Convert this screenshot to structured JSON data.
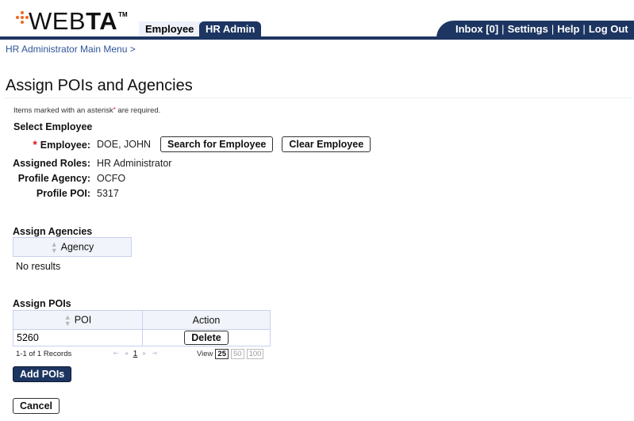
{
  "header": {
    "logo": {
      "text_light": "WEB",
      "text_bold": "TA",
      "trademark": "TM",
      "accent_color": "#f26722"
    },
    "tabs": [
      {
        "label": "Employee",
        "active": false
      },
      {
        "label": "HR Admin",
        "active": true
      }
    ],
    "utility_links": [
      {
        "label": "Inbox [0]"
      },
      {
        "label": "Settings"
      },
      {
        "label": "Help"
      },
      {
        "label": "Log Out"
      }
    ],
    "separator": "|",
    "brand_color": "#1d3561"
  },
  "breadcrumb": {
    "items": [
      "HR Administrator Main Menu"
    ],
    "separator": ">"
  },
  "page": {
    "title": "Assign POIs and Agencies",
    "required_note_prefix": "Items marked with an asterisk",
    "required_note_suffix": " are required.",
    "asterisk": "*"
  },
  "select_employee": {
    "heading": "Select Employee",
    "employee_label": "Employee:",
    "employee_value": "DOE, JOHN",
    "search_button": "Search for Employee",
    "clear_button": "Clear Employee",
    "fields": [
      {
        "label": "Assigned Roles:",
        "value": "HR Administrator"
      },
      {
        "label": "Profile Agency:",
        "value": "OCFO"
      },
      {
        "label": "Profile POI:",
        "value": "5317"
      }
    ]
  },
  "assign_agencies": {
    "heading": "Assign Agencies",
    "columns": [
      "Agency"
    ],
    "empty_text": "No results"
  },
  "assign_pois": {
    "heading": "Assign POIs",
    "columns": [
      "POI",
      "Action"
    ],
    "rows": [
      {
        "poi": "5260",
        "action": "Delete"
      }
    ],
    "pager": {
      "records": "1-1 of 1 Records",
      "first": "⇤",
      "prev": "◂",
      "current_page": "1",
      "next": "▸",
      "last": "⇥",
      "view_label": "View",
      "view_options": [
        "25",
        "50",
        "100"
      ],
      "selected_view": "25"
    },
    "add_button": "Add POIs"
  },
  "footer": {
    "cancel_button": "Cancel"
  }
}
